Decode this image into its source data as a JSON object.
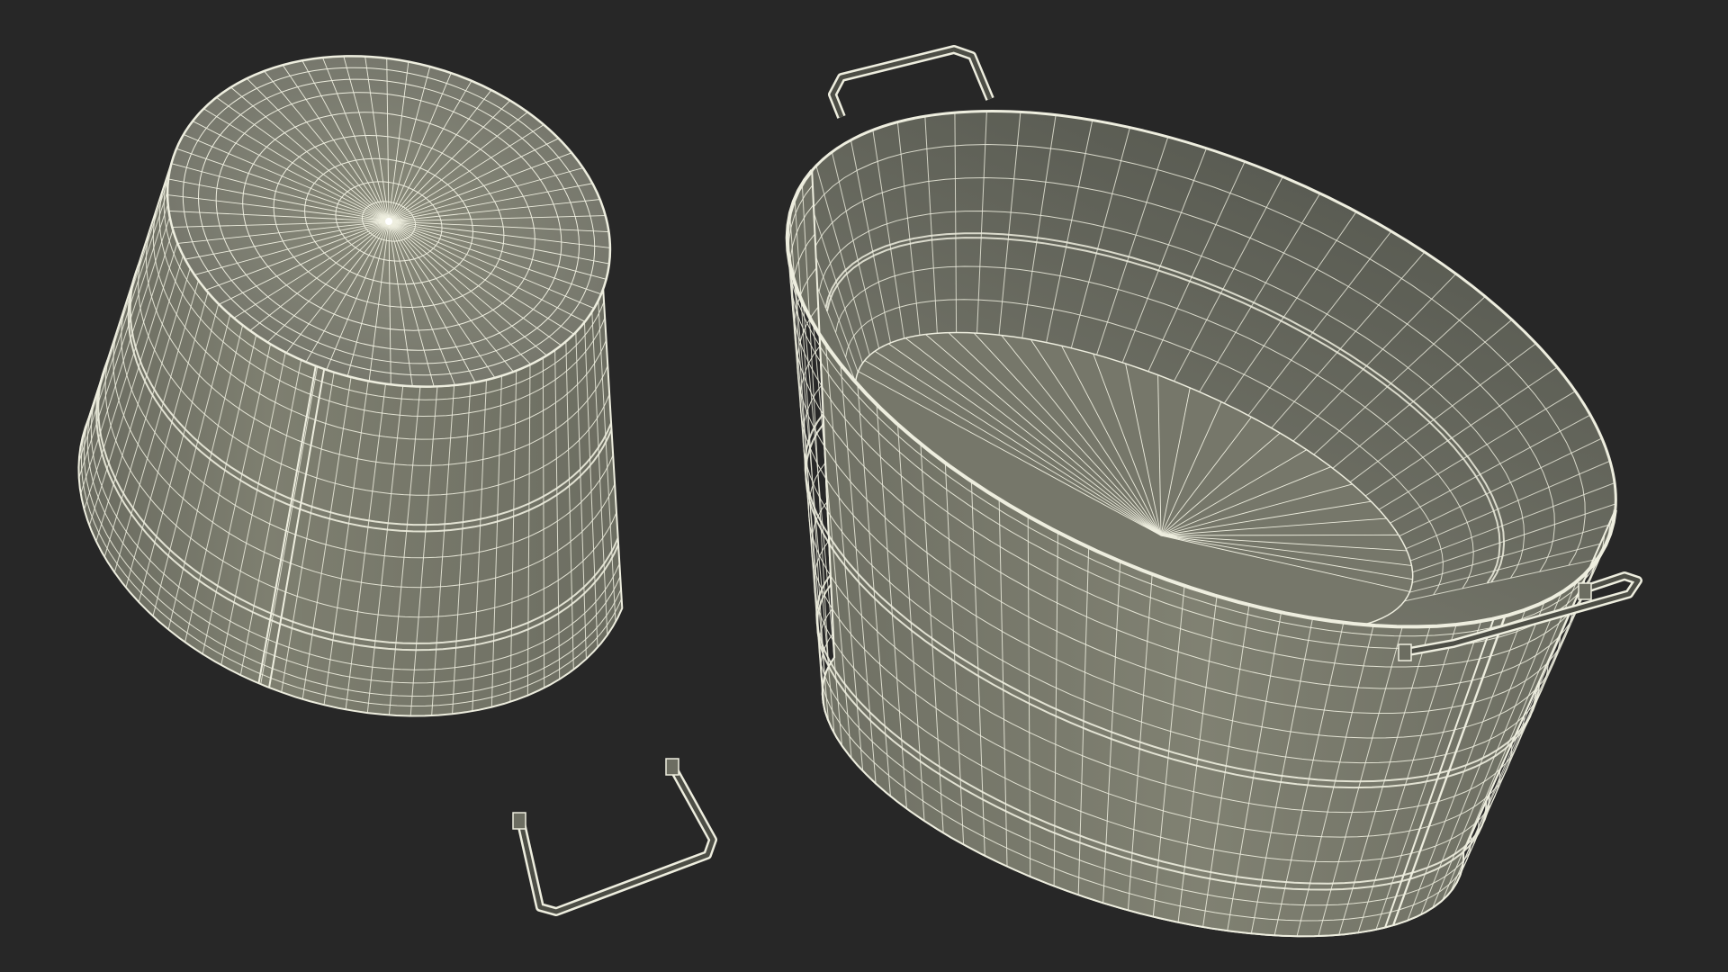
{
  "scene": {
    "background_color": "#272727",
    "surface_color": "#7b7c6c",
    "surface_dark_color": "#5f6156",
    "interior_color": "#6a6b5e",
    "wire_color": "#eeeedf",
    "objects": [
      {
        "name": "oval-tub-upside-down",
        "description_kind": "wireframe galvanized oval tub, bottom up, two handles"
      },
      {
        "name": "oval-tub-upright",
        "description_kind": "wireframe galvanized oval tub, opening up, two handles"
      }
    ]
  }
}
